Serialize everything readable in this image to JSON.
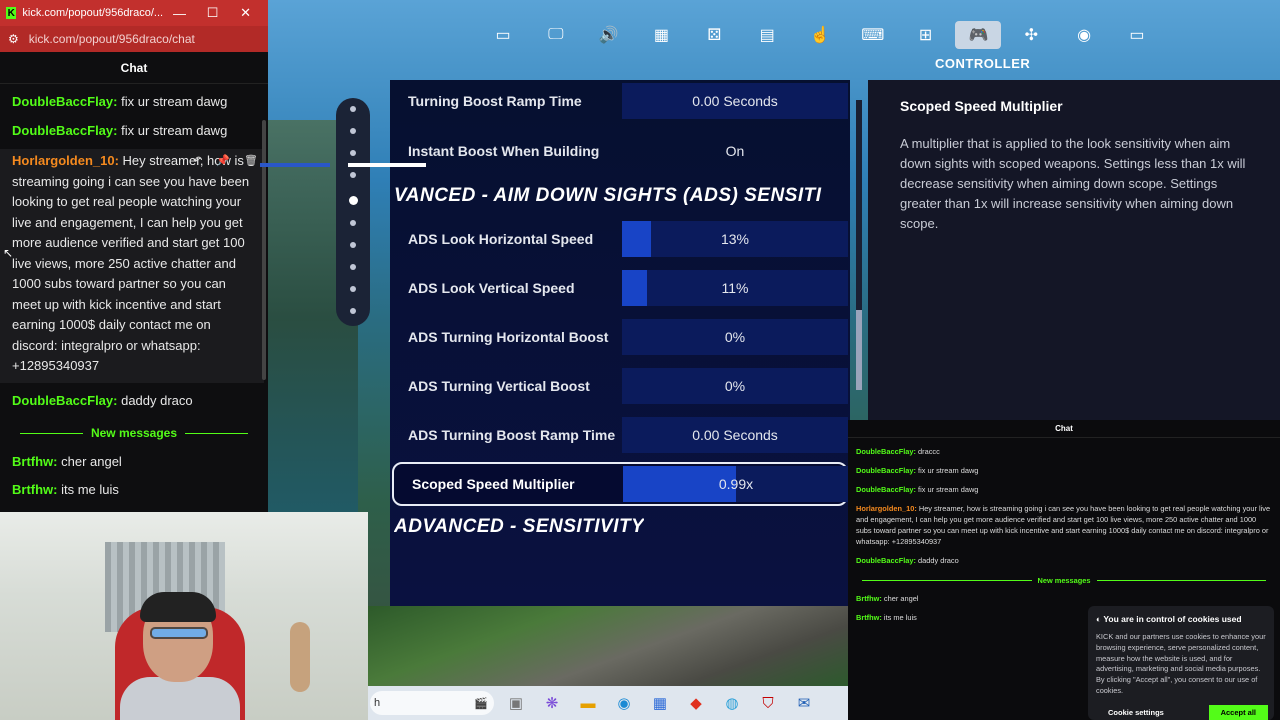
{
  "browser": {
    "tab_title": "kick.com/popout/956draco/...",
    "url": "kick.com/popout/956draco/chat",
    "window_controls": [
      "—",
      "☐",
      "✕"
    ]
  },
  "chat": {
    "header": "Chat",
    "messages": [
      {
        "user": "DoubleBaccFlay:",
        "text": " fix ur stream dawg"
      },
      {
        "user": "DoubleBaccFlay:",
        "text": " fix ur stream dawg"
      }
    ],
    "highlight": {
      "user": "Horlargolden_10:",
      "text": " Hey streamer, how is streaming going i can see you have been looking to get real people watching your live and engagement, I can help you get more audience verified and start get 100 live views, more 250 active chatter and 1000 subs toward partner so you can meet up with kick incentive and start earning 1000$ daily contact me on discord: integralpro or whatsapp: +12895340937"
    },
    "after": {
      "user": "DoubleBaccFlay:",
      "text": " daddy draco"
    },
    "new_messages": "New messages",
    "recent": [
      {
        "user": "Brtfhw:",
        "text": " cher angel"
      },
      {
        "user": "Brtfhw:",
        "text": " its me luis"
      }
    ]
  },
  "game": {
    "section_label": "CONTROLLER",
    "nav_icons": [
      "lb-icon",
      "monitor-icon",
      "speaker-icon",
      "grid-icon",
      "gamepad-icon",
      "window-icon",
      "touch-icon",
      "accessibility-icon",
      "network-icon",
      "controller-icon",
      "wireless-controller-icon",
      "account-icon",
      "rb-icon"
    ],
    "rows": [
      {
        "label": "Turning Boost Ramp Time",
        "value": "0.00 Seconds",
        "fill_pct": 0
      },
      {
        "label": "Instant Boost When Building",
        "value": "On",
        "fill_pct": 0
      },
      {
        "label": "ADS Look Horizontal Speed",
        "value": "13%",
        "fill_pct": 13
      },
      {
        "label": "ADS Look Vertical Speed",
        "value": "11%",
        "fill_pct": 11
      },
      {
        "label": "ADS Turning Horizontal Boost",
        "value": "0%",
        "fill_pct": 0
      },
      {
        "label": "ADS Turning Vertical Boost",
        "value": "0%",
        "fill_pct": 0
      },
      {
        "label": "ADS Turning Boost Ramp Time",
        "value": "0.00 Seconds",
        "fill_pct": 0
      },
      {
        "label": "Scoped Speed Multiplier",
        "value": "0.99x",
        "fill_pct": 50
      }
    ],
    "section_ads": "VANCED - AIM DOWN SIGHTS (ADS) SENSITI",
    "section_adv": "ADVANCED - SENSITIVITY",
    "desc_title": "Scoped Speed Multiplier",
    "desc_text": "A multiplier that is applied to the look sensitivity when aim down sights with scoped weapons.  Settings less than 1x will decrease sensitivity when aiming down scope.  Settings greater than 1x will increase sensitivity when aiming down scope."
  },
  "mini_chat": {
    "header": "Chat",
    "lines": [
      {
        "user": "DoubleBaccFlay:",
        "text": " draccc"
      },
      {
        "user": "DoubleBaccFlay:",
        "text": " fix ur stream dawg"
      },
      {
        "user": "DoubleBaccFlay:",
        "text": " fix ur stream dawg"
      }
    ],
    "highlight": {
      "user": "Horlargolden_10:",
      "text": " Hey streamer, how is streaming going i can see you have been looking to get real people watching your live and engagement, I can help you get more audience verified and start get 100 live views, more 250 active chatter and 1000 subs toward partner so you can meet up with kick incentive and start earning 1000$ daily contact me on discord: integralpro or whatsapp: +12895340937"
    },
    "after": {
      "user": "DoubleBaccFlay:",
      "text": " daddy draco"
    },
    "new_messages": "New messages",
    "recent": [
      {
        "user": "Brtfhw:",
        "text": " cher angel"
      },
      {
        "user": "Brtfhw:",
        "text": " its me luis"
      }
    ]
  },
  "cookie": {
    "title": "You are in control of cookies used",
    "body": "KICK and our partners use cookies to enhance your browsing experience, serve personalized content, measure how the website is used, and for advertising, marketing and social media purposes. By clicking \"Accept all\", you consent to our use of cookies.",
    "settings_btn": "Cookie settings",
    "accept_btn": "Accept all"
  },
  "taskbar": {
    "search_text": "h",
    "icons": [
      "search-icon",
      "folder-icon",
      "copilot-icon",
      "explorer-icon",
      "edge-icon",
      "store-icon",
      "app-icon",
      "chrome-icon",
      "mcafee-icon",
      "outlook-icon"
    ]
  },
  "colors": {
    "kick_green": "#53fc18",
    "highlight_orange": "#f58a1f",
    "browser_red": "#c2302d",
    "slider_fill": "#1844c6"
  }
}
